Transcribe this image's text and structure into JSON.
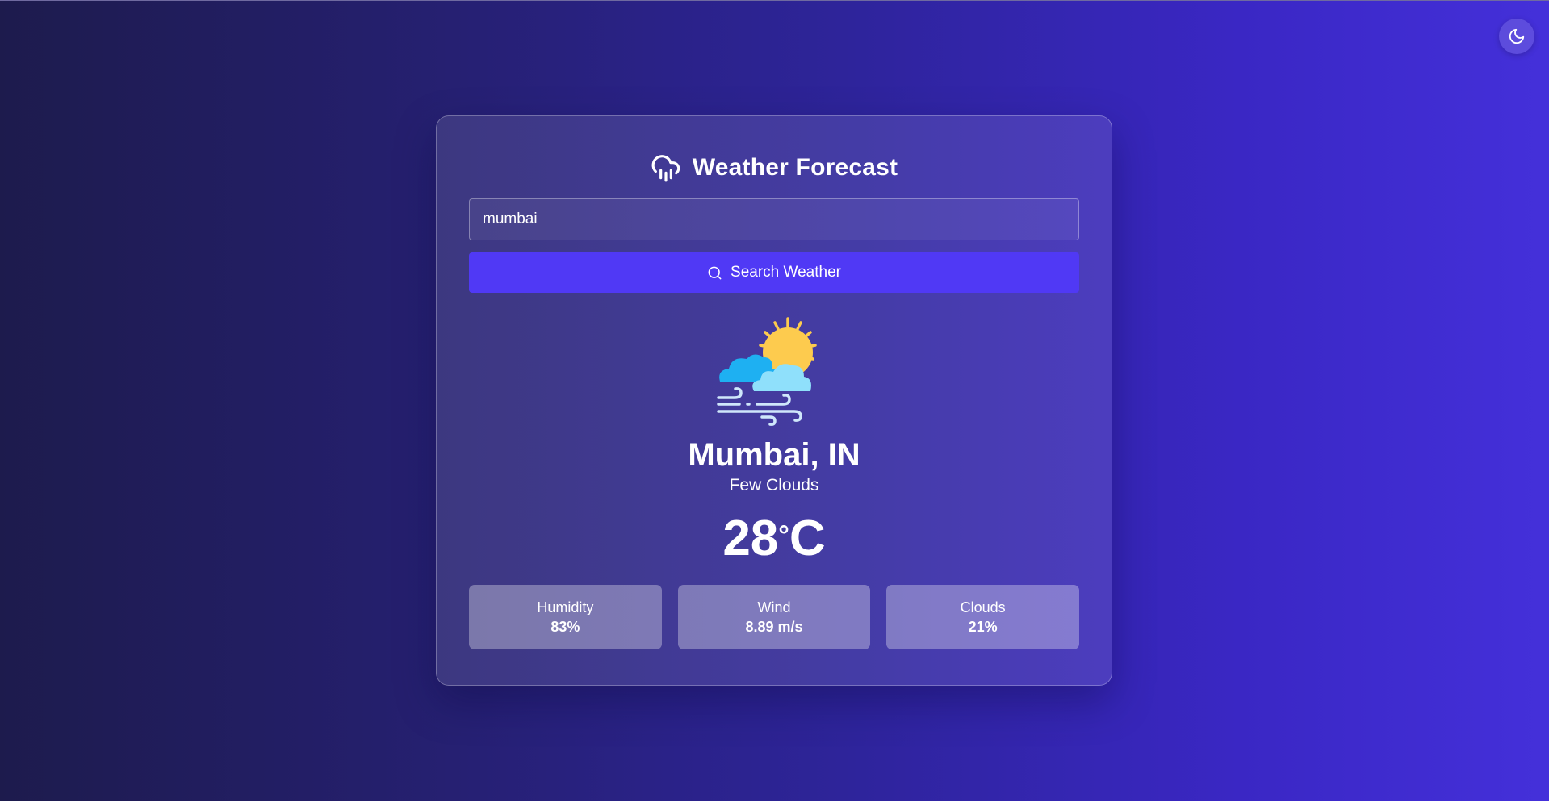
{
  "header": {
    "title": "Weather Forecast",
    "icon": "cloud-rain-icon"
  },
  "search": {
    "value": "mumbai",
    "button_label": "Search Weather"
  },
  "theme_toggle": {
    "icon": "moon-icon"
  },
  "weather": {
    "icon": "partly-cloudy-windy-icon",
    "city": "Mumbai, IN",
    "description": "Few Clouds",
    "temperature": "28",
    "unit": "C",
    "degree_symbol": "°"
  },
  "stats": [
    {
      "label": "Humidity",
      "value": "83%"
    },
    {
      "label": "Wind",
      "value": "8.89 m/s"
    },
    {
      "label": "Clouds",
      "value": "21%"
    }
  ],
  "colors": {
    "accent": "#5039f5",
    "sun": "#fdcb4e",
    "cloud_dark": "#1eb0f2",
    "cloud_light": "#8fe0fb"
  }
}
